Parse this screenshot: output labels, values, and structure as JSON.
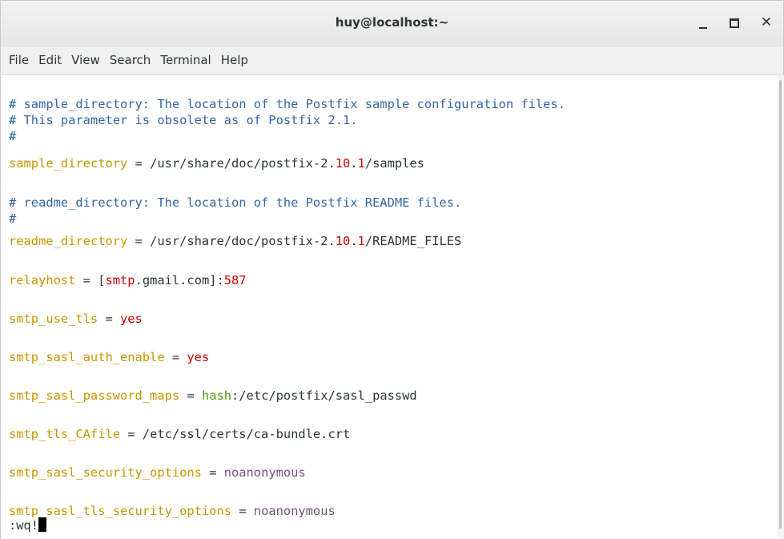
{
  "window": {
    "title": "huy@localhost:~",
    "close_glyph": "✕"
  },
  "menu": [
    "File",
    "Edit",
    "View",
    "Search",
    "Terminal",
    "Help"
  ],
  "lines": {
    "l1": "# sample_directory: The location of the Postfix sample configuration files.",
    "l2": "# This parameter is obsolete as of Postfix 2.1.",
    "l3": "#",
    "l4a": "sample_directory",
    "l4b": " = /usr/share/doc/postfix-2.",
    "l4c": "10",
    "l4d": ".",
    "l4e": "1",
    "l4f": "/samples",
    "l5": "# readme_directory: The location of the Postfix README files.",
    "l6": "#",
    "l7a": "readme_directory",
    "l7b": " = /usr/share/doc/postfix-2.",
    "l7c": "10",
    "l7d": ".",
    "l7e": "1",
    "l7f": "/README_FILES",
    "l8a": "relayhost",
    "l8b": " = [",
    "l8c": "smtp",
    "l8d": ".gmail.com]:",
    "l8e": "587",
    "l9a": "smtp_use_tls",
    "l9b": " = ",
    "l9c": "yes",
    "l10a": "smtp_sasl_auth_enable",
    "l10b": " = ",
    "l10c": "yes",
    "l11a": "smtp_sasl_password_maps",
    "l11b": " = ",
    "l11c": "hash",
    "l11d": ":/etc/postfix/sasl_passwd",
    "l12a": "smtp_tls_CAfile",
    "l12b": " = /etc/ssl/certs/ca-bundle.crt",
    "l13a": "smtp_sasl_security_options",
    "l13b": " = ",
    "l13c": "noanonymous",
    "l14a": "smtp_sasl_tls_security_options",
    "l14b": " = ",
    "l14c": "noanonymous",
    "cmd": ":wq!"
  }
}
